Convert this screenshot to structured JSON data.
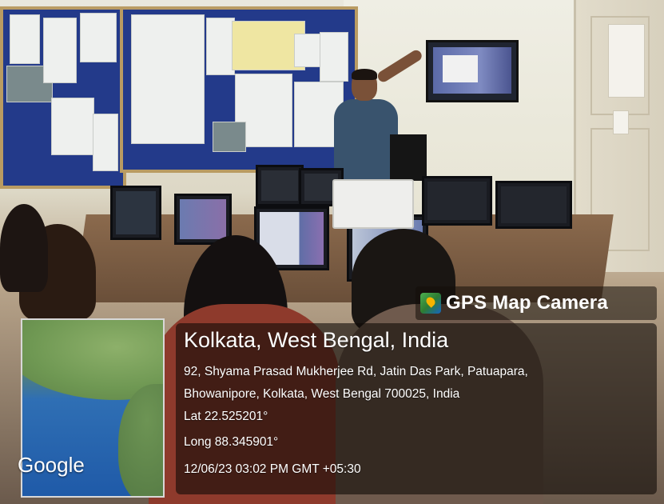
{
  "overlay": {
    "app_label": "GPS Map Camera",
    "app_icon": "map-pin-icon",
    "location": "Kolkata, West Bengal, India",
    "address_line1": "92, Shyama Prasad Mukherjee Rd, Jatin Das Park, Patuapara,",
    "address_line2": "Bhowanipore, Kolkata, West Bengal 700025, India",
    "latitude": "Lat 22.525201°",
    "longitude": "Long 88.345901°",
    "timestamp": "12/06/23 03:02 PM GMT +05:30",
    "map_attribution": "Google"
  },
  "colors": {
    "overlay_background": "#140e0a",
    "overlay_text": "#ffffff"
  }
}
